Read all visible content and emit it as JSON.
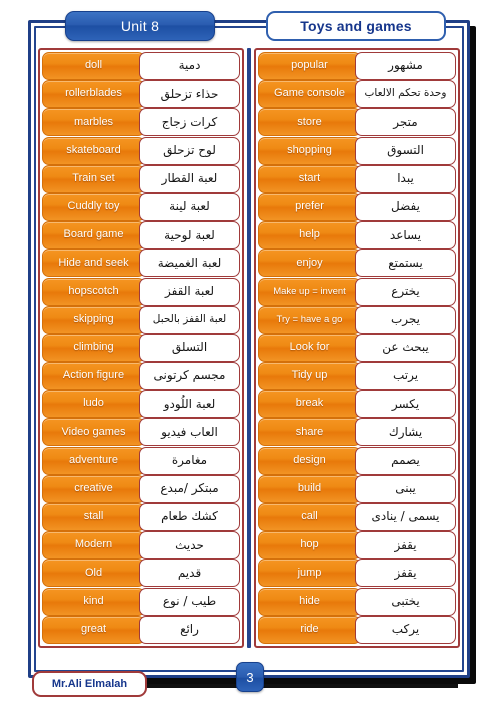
{
  "header": {
    "unit_label": "Unit 8",
    "topic_label": "Toys and games"
  },
  "footer": {
    "author": "Mr.Ali Elmalah",
    "page_number": "3"
  },
  "colors": {
    "frame_navy": "#1f3f87",
    "term_orange": "#ef8a14",
    "cell_border_red": "#a03a3a",
    "badge_blue": "#2a5cb0",
    "topic_text_navy": "#16368c"
  },
  "vocab": {
    "left_column": [
      {
        "term": "doll",
        "meaning": "دمية"
      },
      {
        "term": "rollerblades",
        "meaning": "حذاء تزحلق"
      },
      {
        "term": "marbles",
        "meaning": "كرات زجاج"
      },
      {
        "term": "skateboard",
        "meaning": "لوح تزحلق"
      },
      {
        "term": "Train set",
        "meaning": "لعبة القطار"
      },
      {
        "term": "Cuddly toy",
        "meaning": "لعبة لينة"
      },
      {
        "term": "Board game",
        "meaning": "لعبة لوحية"
      },
      {
        "term": "Hide and seek",
        "meaning": "لعبة الغميضة"
      },
      {
        "term": "hopscotch",
        "meaning": "لعبة القفز"
      },
      {
        "term": "skipping",
        "meaning": "لعبة القفز بالحبل"
      },
      {
        "term": "climbing",
        "meaning": "التسلق"
      },
      {
        "term": "Action figure",
        "meaning": "مجسم كرتونى"
      },
      {
        "term": "ludo",
        "meaning": "لعبة اللُودو"
      },
      {
        "term": "Video games",
        "meaning": "العاب فيديو"
      },
      {
        "term": "adventure",
        "meaning": "مغامرة"
      },
      {
        "term": "creative",
        "meaning": "مبتكر /مبدع"
      },
      {
        "term": "stall",
        "meaning": "كشك طعام"
      },
      {
        "term": "Modern",
        "meaning": "حديث"
      },
      {
        "term": "Old",
        "meaning": "قديم"
      },
      {
        "term": "kind",
        "meaning": "طيب / نوع"
      },
      {
        "term": "great",
        "meaning": "رائع"
      }
    ],
    "right_column": [
      {
        "term": "popular",
        "meaning": "مشهور"
      },
      {
        "term": "Game console",
        "meaning": "وحدة تحكم الالعاب"
      },
      {
        "term": "store",
        "meaning": "متجر"
      },
      {
        "term": "shopping",
        "meaning": "التسوق"
      },
      {
        "term": "start",
        "meaning": "يبدا"
      },
      {
        "term": "prefer",
        "meaning": "يفضل"
      },
      {
        "term": "help",
        "meaning": "يساعد"
      },
      {
        "term": "enjoy",
        "meaning": "يستمتع"
      },
      {
        "term": "Make up = invent",
        "meaning": "يخترع"
      },
      {
        "term": "Try = have a go",
        "meaning": "يجرب"
      },
      {
        "term": "Look for",
        "meaning": "يبحث عن"
      },
      {
        "term": "Tidy up",
        "meaning": "يرتب"
      },
      {
        "term": "break",
        "meaning": "يكسر"
      },
      {
        "term": "share",
        "meaning": "يشارك"
      },
      {
        "term": "design",
        "meaning": "يصمم"
      },
      {
        "term": "build",
        "meaning": "يبنى"
      },
      {
        "term": "call",
        "meaning": "يسمى / ينادى"
      },
      {
        "term": "hop",
        "meaning": "يقفز"
      },
      {
        "term": "jump",
        "meaning": "يقفز"
      },
      {
        "term": "hide",
        "meaning": "يختبى"
      },
      {
        "term": "ride",
        "meaning": "يركب"
      }
    ]
  }
}
